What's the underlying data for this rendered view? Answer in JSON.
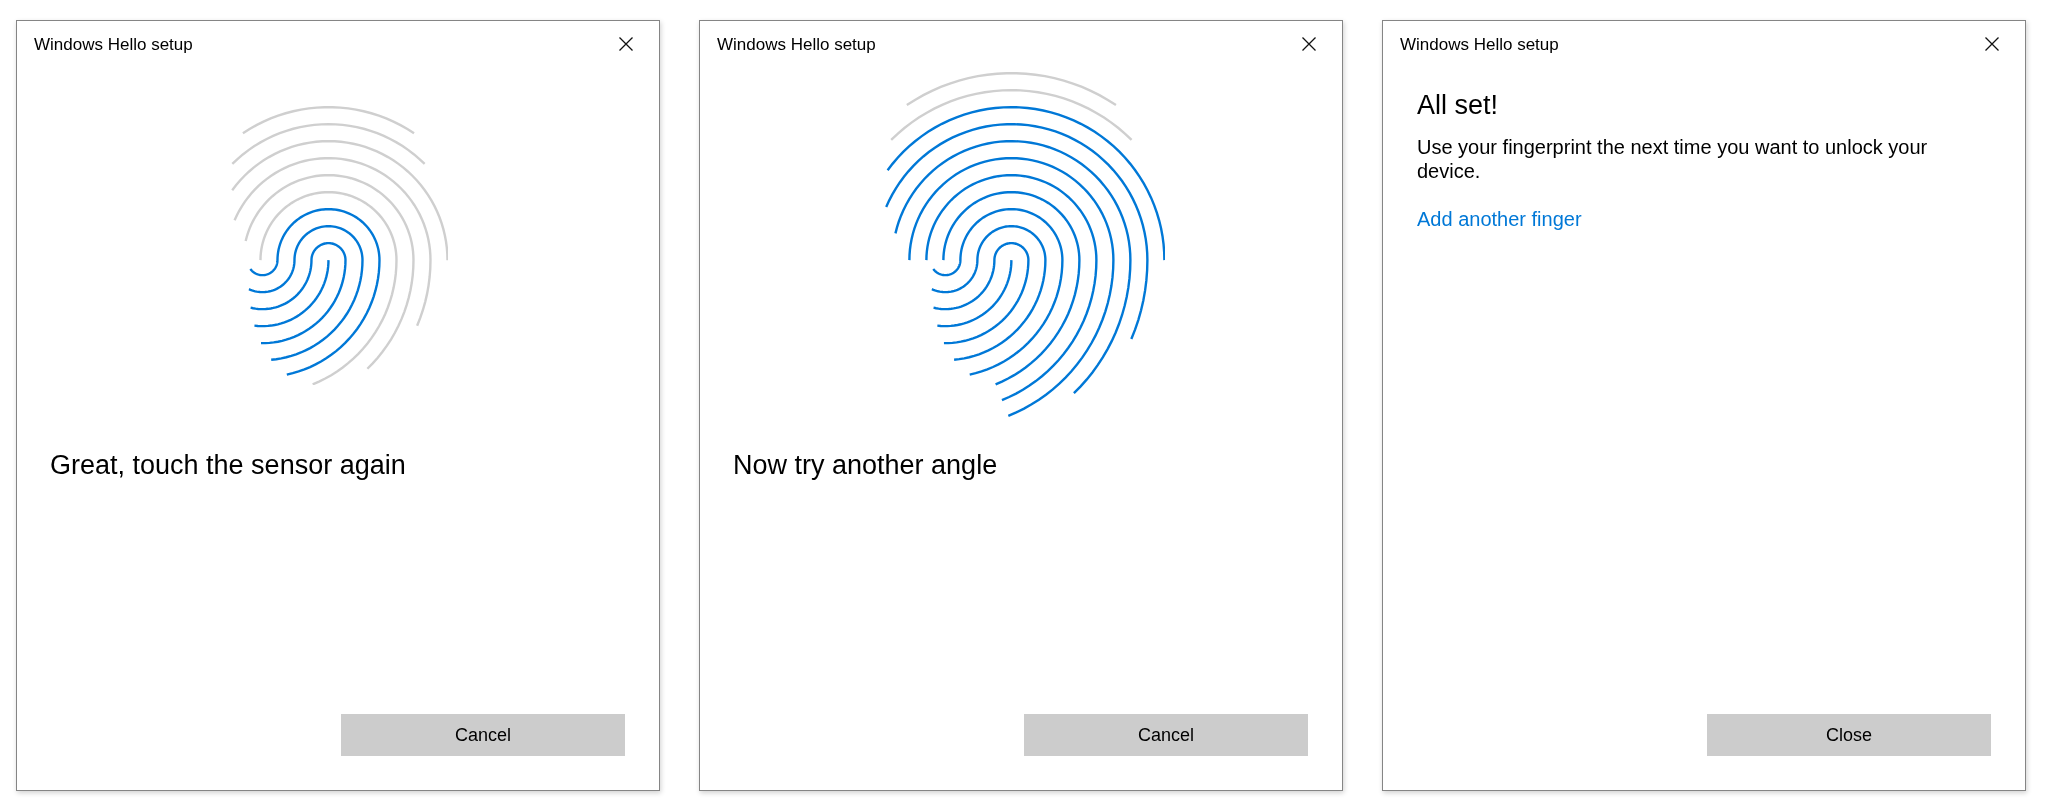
{
  "windows": [
    {
      "kind": "scan",
      "title": "Windows Hello setup",
      "fingerprint": {
        "kind": "partial"
      },
      "message": "Great, touch the sensor again",
      "button": "Cancel"
    },
    {
      "kind": "scan",
      "title": "Windows Hello setup",
      "fingerprint": {
        "kind": "extended"
      },
      "message": "Now try another angle",
      "button": "Cancel"
    },
    {
      "kind": "done",
      "title": "Windows Hello setup",
      "heading": "All set!",
      "body": "Use your fingerprint the next time you want to unlock your device.",
      "link": "Add another finger",
      "button": "Close"
    }
  ]
}
